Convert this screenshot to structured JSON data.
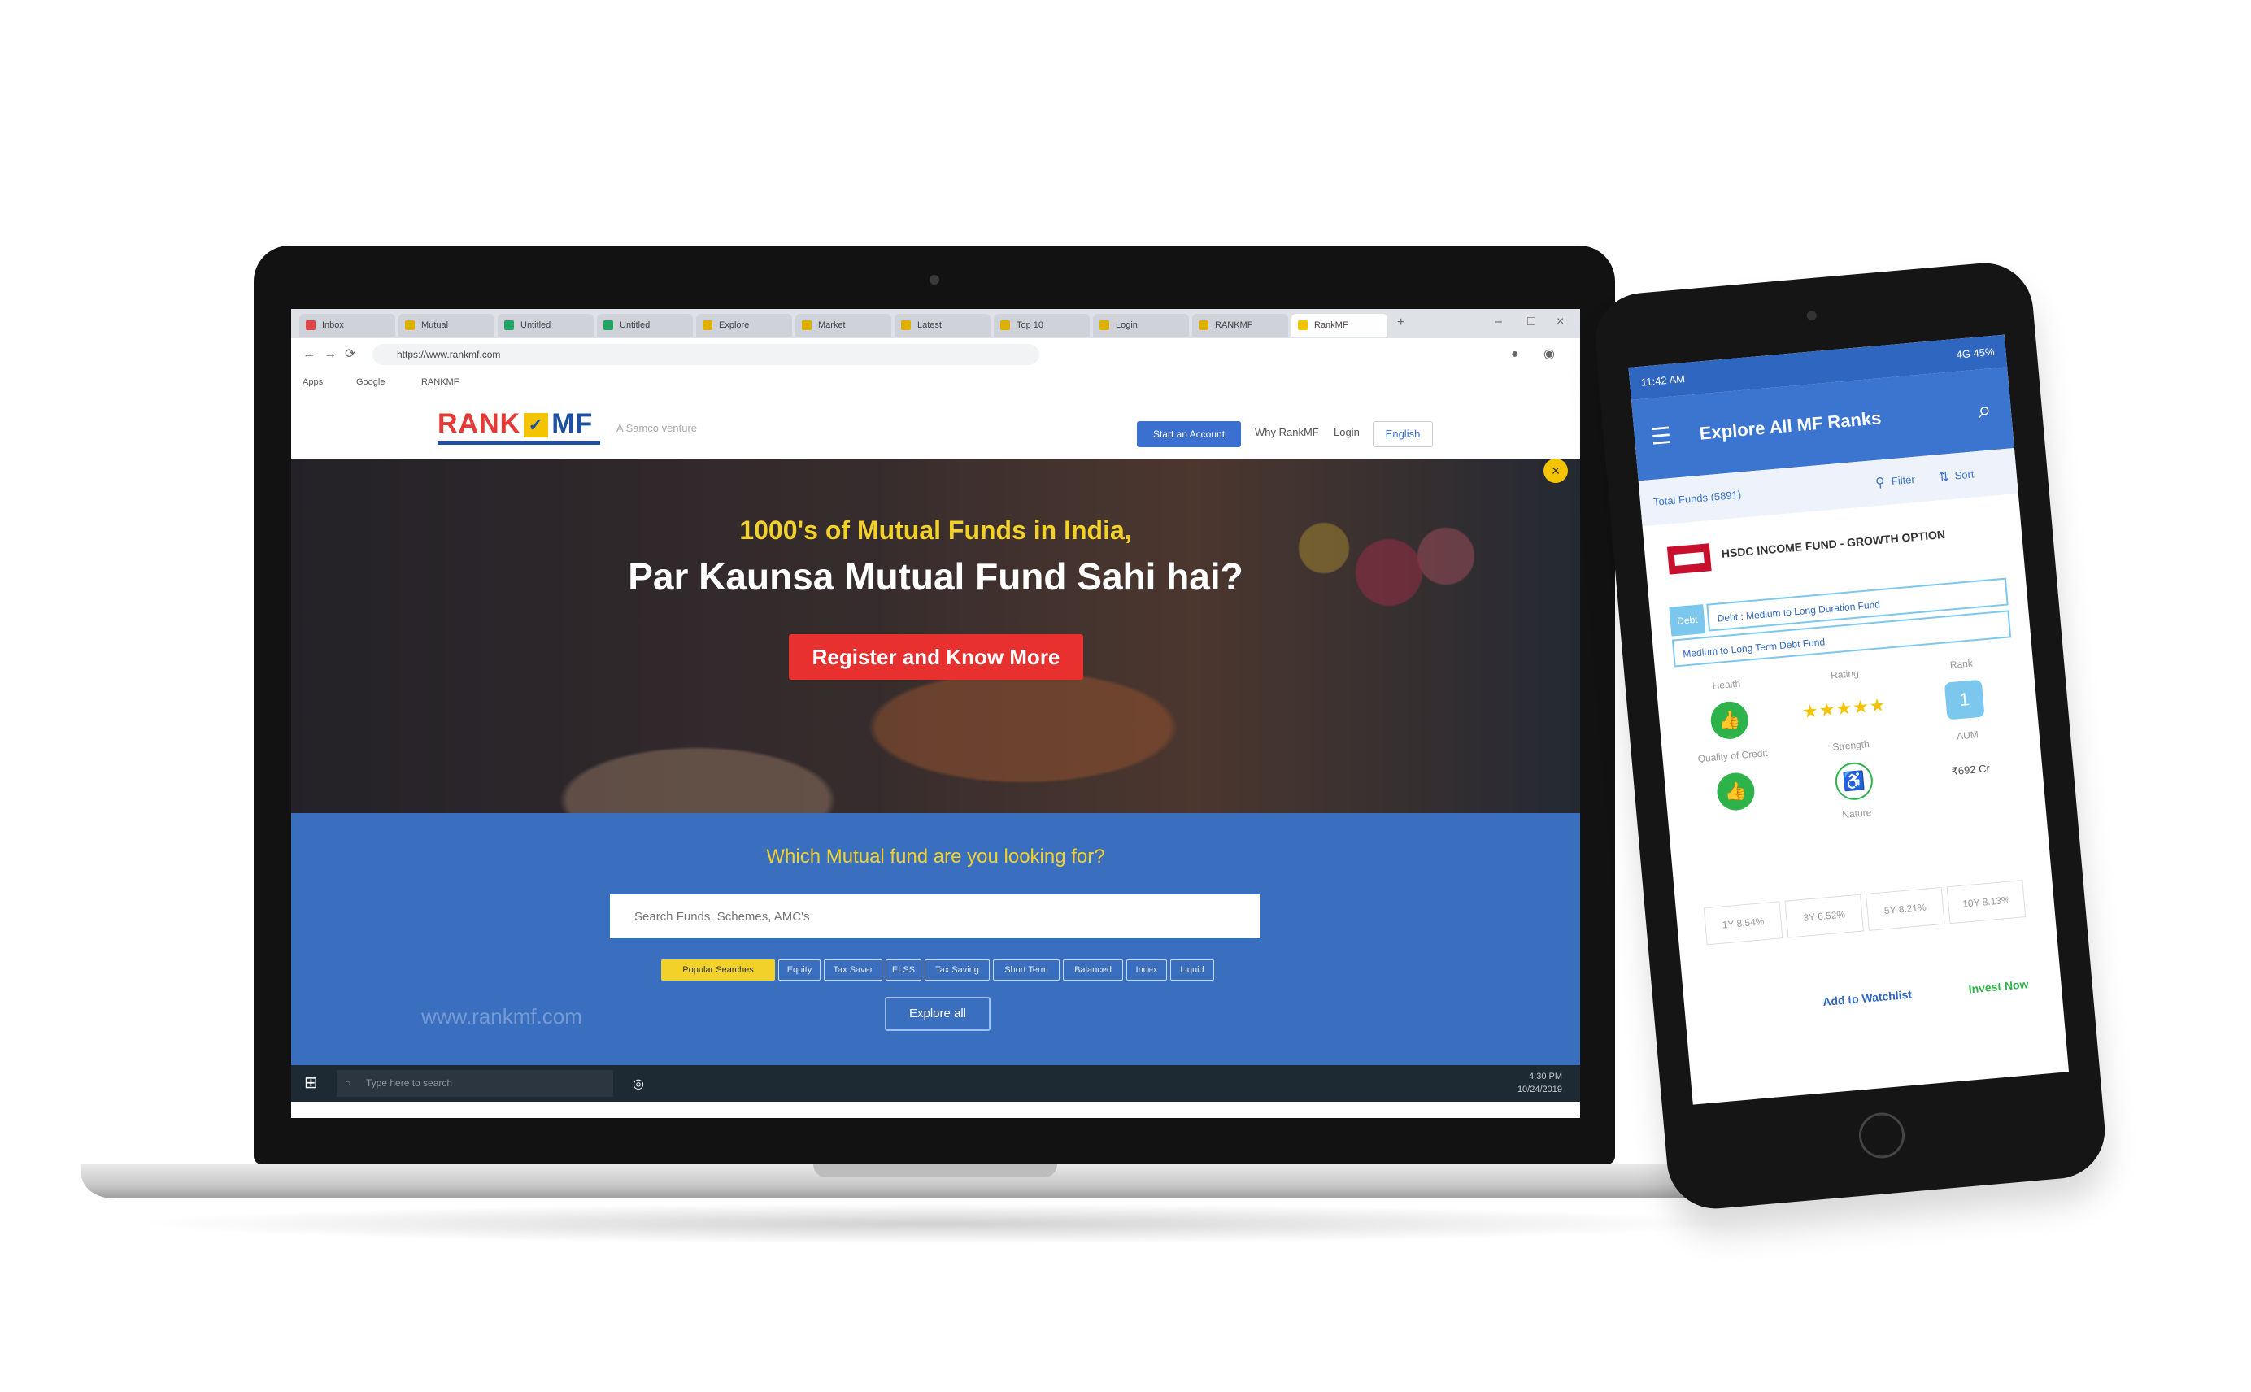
{
  "browser": {
    "tabs": [
      "Inbox",
      "Mutual",
      "Untitled",
      "Untitled",
      "Explore",
      "Market",
      "Latest",
      "Top 10",
      "Login",
      "RANKMF",
      "RankMF"
    ],
    "url": "https://www.rankmf.com",
    "bookmarks": [
      "Apps",
      "Google",
      "RANKMF"
    ]
  },
  "site": {
    "logo_rank": "RANK",
    "logo_badge": "✓",
    "logo_mf": "MF",
    "logo_tag": "A Samco venture",
    "header_button": "Start an Account",
    "header_link_why": "Why RankMF",
    "header_link_login": "Login",
    "language": "English",
    "hero_line1": "1000's of Mutual Funds in India,",
    "hero_line2": "Par Kaunsa Mutual Fund Sahi hai?",
    "hero_cta": "Register and Know More",
    "search_question": "Which Mutual fund are you looking for?",
    "search_placeholder": "Search Funds, Schemes, AMC's",
    "chips": [
      "Popular Searches",
      "Equity",
      "Tax Saver",
      "ELSS",
      "Tax Saving",
      "Short Term",
      "Balanced",
      "Index",
      "Liquid"
    ],
    "explore_button": "Explore all",
    "watermark": "www.rankmf.com"
  },
  "taskbar": {
    "search_placeholder": "Type here to search",
    "time": "4:30 PM",
    "date": "10/24/2019"
  },
  "tablet": {
    "status_time": "11:42 AM",
    "status_right": "4G 45%",
    "title": "Explore All MF Ranks",
    "total_funds": "Total Funds (5891)",
    "filter_label": "Filter",
    "sort_label": "Sort",
    "fund_name": "HSDC INCOME FUND - GROWTH OPTION",
    "fund_tag": "Debt",
    "fund_line1": "Debt : Medium to Long Duration Fund",
    "fund_line2": "Medium to Long Term Debt Fund",
    "metrics": {
      "health_label": "Health",
      "rating_label": "Rating",
      "rank_label": "Rank",
      "rank_value": "1",
      "quality_label": "Quality of Credit",
      "strength_label": "Strength",
      "aum_label": "AUM",
      "aum_value": "₹692 Cr",
      "nature_label": "Nature",
      "stars": "★★★★★"
    },
    "returns": [
      "1Y 8.54%",
      "3Y 6.52%",
      "5Y 8.21%",
      "10Y 8.13%"
    ],
    "add_watchlist": "Add to Watchlist",
    "invest_now": "Invest Now"
  },
  "colors": {
    "brand_blue": "#3b75cf",
    "brand_red": "#e8302f",
    "accent_yellow": "#f2d12b"
  }
}
